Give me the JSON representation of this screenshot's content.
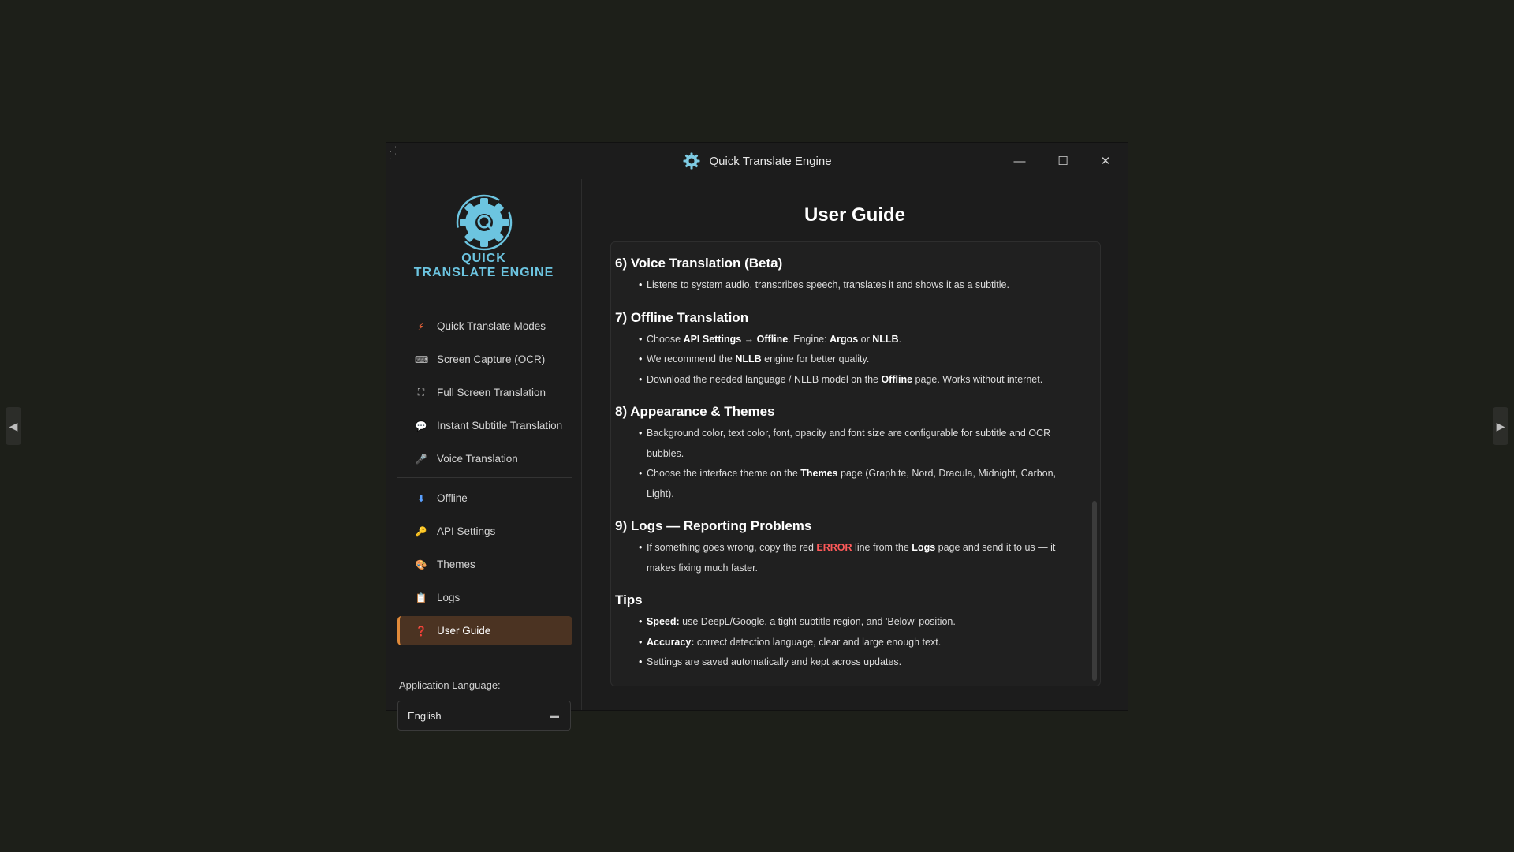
{
  "window": {
    "title": "Quick Translate Engine",
    "controls": {
      "minimize": "—",
      "maximize": "☐",
      "close": "✕"
    }
  },
  "logo": {
    "line1": "QUICK",
    "line2": "TRANSLATE ENGINE"
  },
  "sidebar": {
    "items": [
      {
        "label": "Quick Translate Modes",
        "icon": "lightning-icon",
        "glyph": "⚡",
        "color": "#ff6b3d"
      },
      {
        "label": "Screen Capture (OCR)",
        "icon": "keyboard-icon",
        "glyph": "⌨",
        "color": "#bdbdbd"
      },
      {
        "label": "Full Screen Translation",
        "icon": "fullscreen-icon",
        "glyph": "⛶",
        "color": "#bdbdbd"
      },
      {
        "label": "Instant Subtitle Translation",
        "icon": "speech-bubble-icon",
        "glyph": "💬",
        "color": "#d7d7d7"
      },
      {
        "label": "Voice Translation",
        "icon": "microphone-icon",
        "glyph": "🎤",
        "color": "#bdbdbd"
      },
      {
        "label": "Offline",
        "icon": "download-icon",
        "glyph": "⬇",
        "color": "#5aa0ff"
      },
      {
        "label": "API Settings",
        "icon": "key-icon",
        "glyph": "🔑",
        "color": "#e8b23a"
      },
      {
        "label": "Themes",
        "icon": "palette-icon",
        "glyph": "🎨",
        "color": "#e07a5f"
      },
      {
        "label": "Logs",
        "icon": "clipboard-icon",
        "glyph": "📋",
        "color": "#d6c9a8"
      },
      {
        "label": "User Guide",
        "icon": "question-icon",
        "glyph": "❓",
        "color": "#ff4d4d"
      }
    ],
    "language_label": "Application Language:",
    "language_value": "English",
    "language_arrow": "▬"
  },
  "main": {
    "title": "User Guide",
    "sections": {
      "voice": {
        "heading": "6) Voice Translation (Beta)",
        "b1": "Listens to system audio, transcribes speech, translates it and shows it as a subtitle."
      },
      "offline": {
        "heading": "7) Offline Translation",
        "b1": {
          "t1": "Choose ",
          "b1": "API Settings",
          "t2": " → ",
          "b2": "Offline",
          "t3": ". Engine: ",
          "b3": "Argos",
          "t4": " or ",
          "b4": "NLLB",
          "t5": "."
        },
        "b2": {
          "t1": "We recommend the ",
          "b1": "NLLB",
          "t2": " engine for better quality."
        },
        "b3": {
          "t1": "Download the needed language / NLLB model on the ",
          "b1": "Offline",
          "t2": " page. Works without internet."
        }
      },
      "appearance": {
        "heading": "8) Appearance & Themes",
        "b1": "Background color, text color, font, opacity and font size are configurable for subtitle and OCR bubbles.",
        "b2": {
          "t1": "Choose the interface theme on the ",
          "b1": "Themes",
          "t2": " page (Graphite, Nord, Dracula, Midnight, Carbon, Light)."
        }
      },
      "logs": {
        "heading": "9) Logs — Reporting Problems",
        "b1": {
          "t1": "If something goes wrong, copy the red ",
          "err": "ERROR",
          "t2": " line from the ",
          "b1": "Logs",
          "t3": " page and send it to us — it makes fixing much faster."
        }
      },
      "tips": {
        "heading": "Tips",
        "b1": {
          "b1": "Speed:",
          "t1": " use DeepL/Google, a tight subtitle region, and 'Below' position."
        },
        "b2": {
          "b1": "Accuracy:",
          "t1": " correct detection language, clear and large enough text."
        },
        "b3": "Settings are saved automatically and kept across updates."
      }
    }
  },
  "viewer": {
    "prev": "◀",
    "next": "▶"
  },
  "colors": {
    "accent": "#e08a3a",
    "active_bg": "#4b3322",
    "logo": "#6cc4e0",
    "error": "#ff5a5a"
  }
}
